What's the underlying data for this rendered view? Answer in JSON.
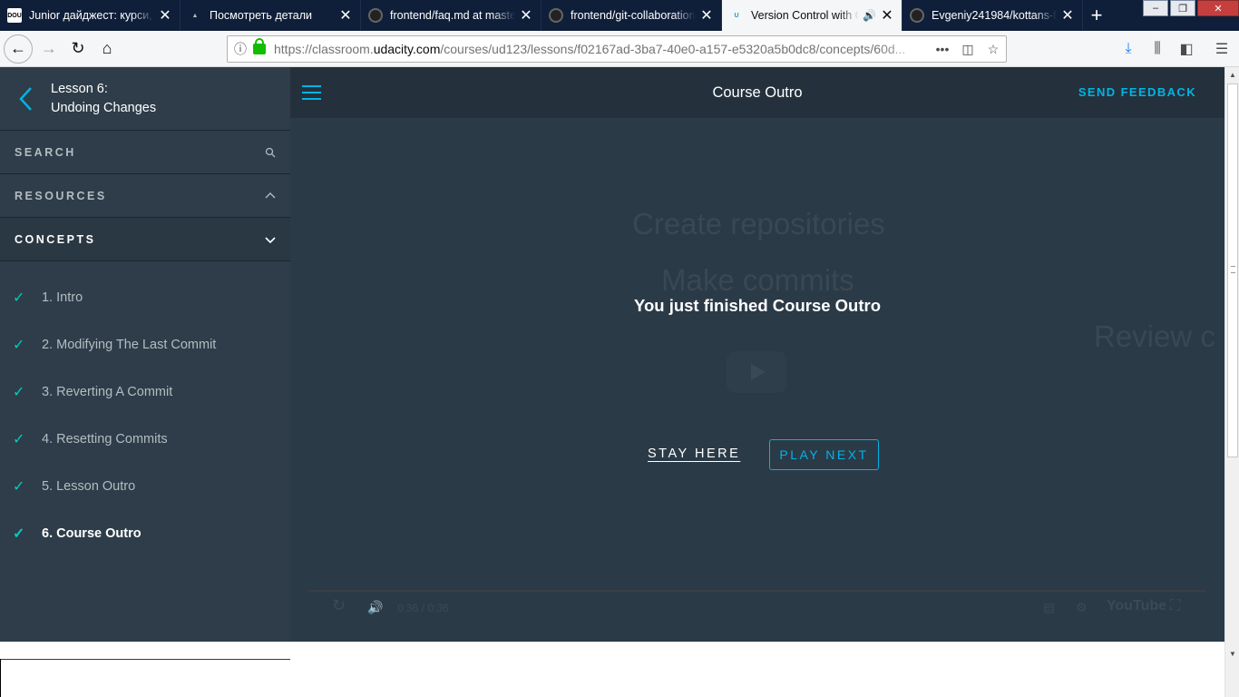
{
  "browser": {
    "tabs": [
      {
        "title": "Junior дайджест: курси, с",
        "favicon": "dou-icon",
        "favicon_text": "DOU"
      },
      {
        "title": "Посмотреть детали",
        "favicon": "graduation-cap-icon"
      },
      {
        "title": "frontend/faq.md at maste",
        "favicon": "github-icon"
      },
      {
        "title": "frontend/git-collaboration",
        "favicon": "github-icon"
      },
      {
        "title": "Version Control with G",
        "favicon": "udacity-icon",
        "favicon_text": "U",
        "active": true,
        "audio": true
      },
      {
        "title": "Evgeniy241984/kottans-fr",
        "favicon": "github-icon"
      }
    ],
    "url_prefix": "https://classroom.",
    "url_host": "udacity.com",
    "url_rest": "/courses/ud123/lessons/f02167ad-3ba7-40e0-a157-e5320a5b0dc8/concepts/60d..."
  },
  "sidebar": {
    "lesson_label": "Lesson 6:",
    "lesson_name": "Undoing Changes",
    "search_label": "SEARCH",
    "resources_label": "RESOURCES",
    "concepts_label": "CONCEPTS",
    "concepts": [
      {
        "label": "1. Intro",
        "done": true
      },
      {
        "label": "2. Modifying The Last Commit",
        "done": true
      },
      {
        "label": "3. Reverting A Commit",
        "done": true
      },
      {
        "label": "4. Resetting Commits",
        "done": true
      },
      {
        "label": "5. Lesson Outro",
        "done": true
      },
      {
        "label": "6. Course Outro",
        "done": true,
        "current": true
      }
    ]
  },
  "main": {
    "title": "Course Outro",
    "send_feedback": "SEND FEEDBACK",
    "finished_text": "You just finished Course Outro",
    "stay_here": "STAY HERE",
    "play_next": "PLAY NEXT",
    "video_bg_text": [
      "Create repositories",
      "Make commits",
      "Review c"
    ],
    "video_time": "0:36 / 0:36",
    "video_brand": "YouTube"
  },
  "colors": {
    "accent": "#02b3e4",
    "check": "#02ccba",
    "sidebar_bg": "#2e3d49",
    "header_bg": "#24313c"
  }
}
